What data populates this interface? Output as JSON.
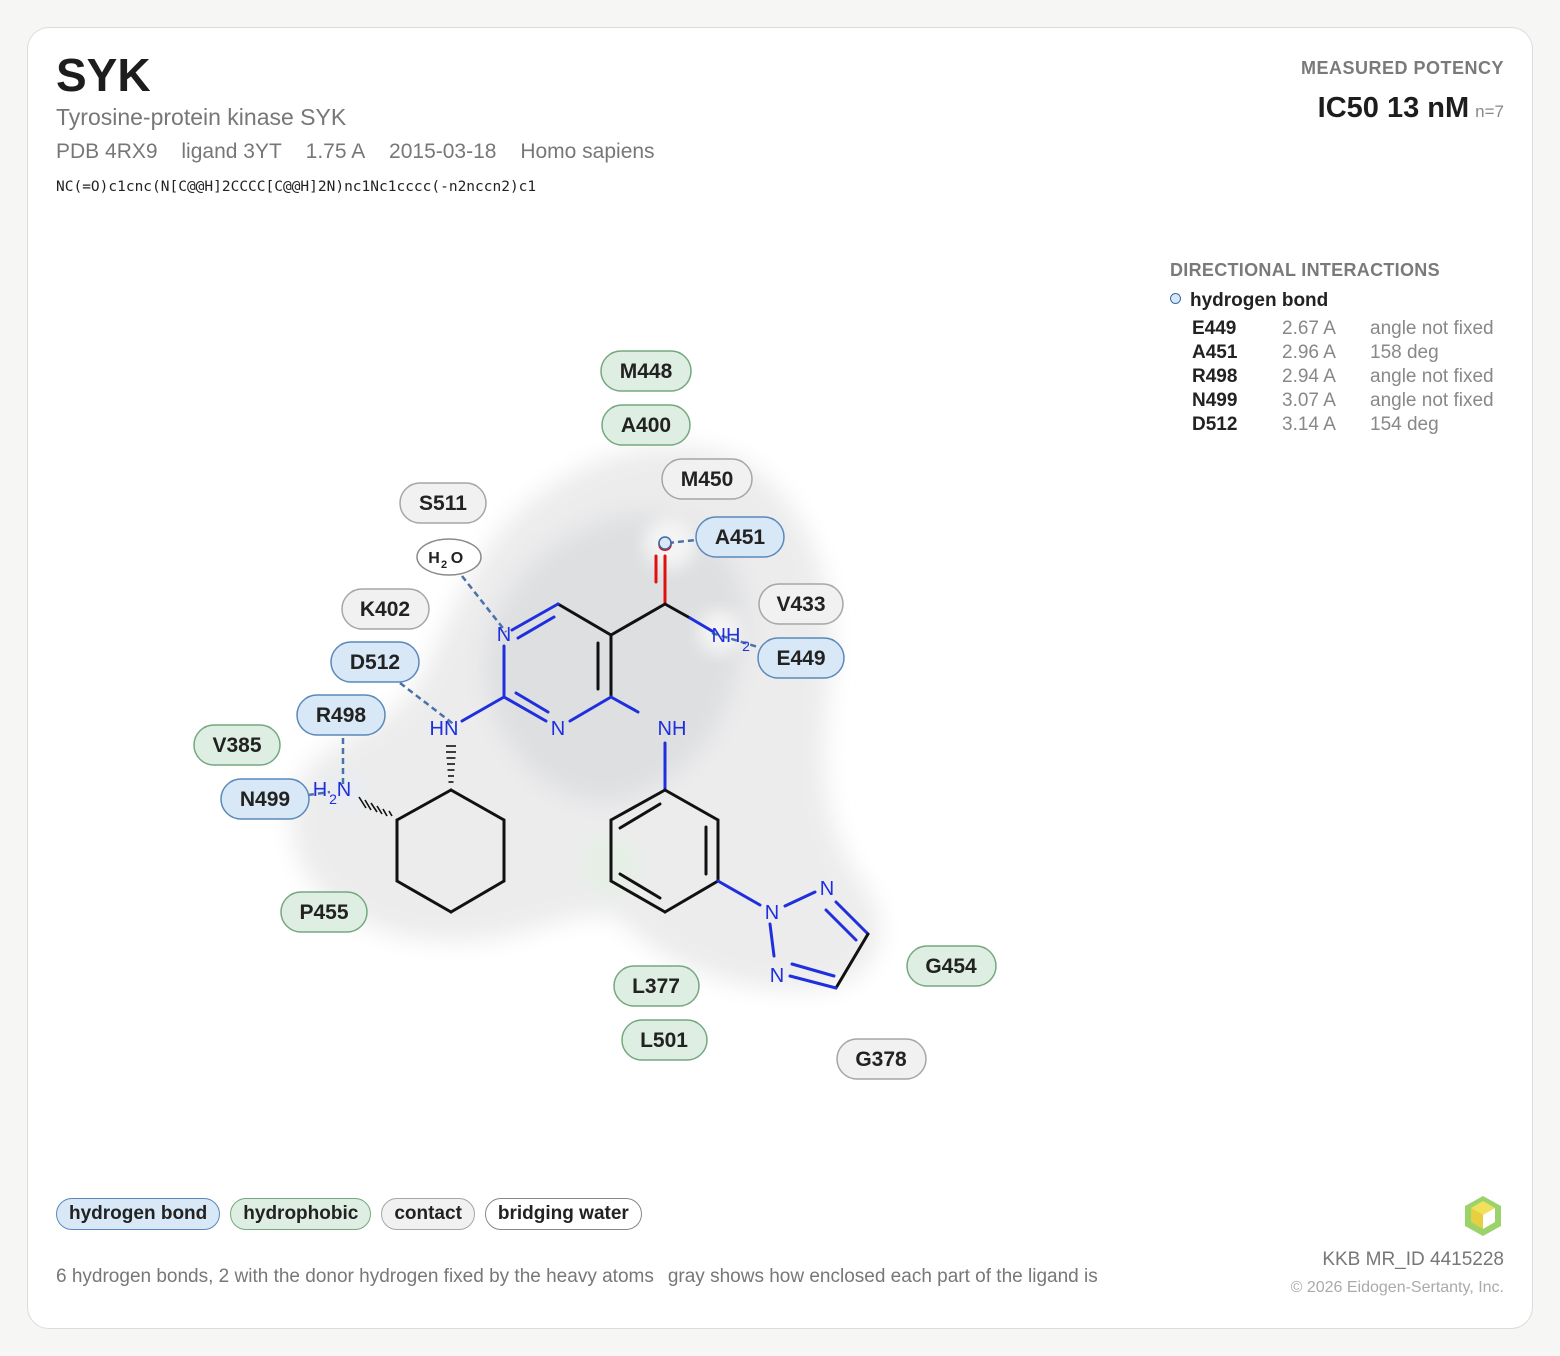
{
  "header": {
    "title": "SYK",
    "subtitle": "Tyrosine-protein kinase SYK",
    "meta": [
      "PDB 4RX9",
      "ligand 3YT",
      "1.75 A",
      "2015-03-18",
      "Homo sapiens"
    ],
    "smiles": "NC(=O)c1cnc(N[C@@H]2CCCC[C@@H]2N)nc1Nc1cccc(-n2nccn2)c1"
  },
  "potency": {
    "label": "MEASURED POTENCY",
    "value": "IC50 13 nM",
    "n": "n=7"
  },
  "interactions": {
    "heading": "DIRECTIONAL INTERACTIONS",
    "type": "hydrogen bond",
    "rows": [
      {
        "residue": "E449",
        "distance": "2.67 A",
        "angle": "angle not fixed"
      },
      {
        "residue": "A451",
        "distance": "2.96 A",
        "angle": "158 deg"
      },
      {
        "residue": "R498",
        "distance": "2.94 A",
        "angle": "angle not fixed"
      },
      {
        "residue": "N499",
        "distance": "3.07 A",
        "angle": "angle not fixed"
      },
      {
        "residue": "D512",
        "distance": "3.14 A",
        "angle": "154 deg"
      }
    ]
  },
  "residues": {
    "M448": {
      "label": "M448",
      "kind": "hydrophobic"
    },
    "A400": {
      "label": "A400",
      "kind": "hydrophobic"
    },
    "M450": {
      "label": "M450",
      "kind": "contact"
    },
    "S511": {
      "label": "S511",
      "kind": "contact"
    },
    "A451": {
      "label": "A451",
      "kind": "hydrogen bond"
    },
    "K402": {
      "label": "K402",
      "kind": "contact"
    },
    "V433": {
      "label": "V433",
      "kind": "contact"
    },
    "D512": {
      "label": "D512",
      "kind": "hydrogen bond"
    },
    "E449": {
      "label": "E449",
      "kind": "hydrogen bond"
    },
    "R498": {
      "label": "R498",
      "kind": "hydrogen bond"
    },
    "V385": {
      "label": "V385",
      "kind": "hydrophobic"
    },
    "N499": {
      "label": "N499",
      "kind": "hydrogen bond"
    },
    "P455": {
      "label": "P455",
      "kind": "hydrophobic"
    },
    "L377": {
      "label": "L377",
      "kind": "hydrophobic"
    },
    "L501": {
      "label": "L501",
      "kind": "hydrophobic"
    },
    "G454": {
      "label": "G454",
      "kind": "hydrophobic"
    },
    "G378": {
      "label": "G378",
      "kind": "contact"
    }
  },
  "atoms": {
    "N_ring1": "N",
    "N_ring2": "N",
    "NH_left": "HN",
    "NH_right": "NH",
    "O_amide": "O",
    "NH2_amide": "NH",
    "NH2_amide_sub": "2",
    "NH2_cyclo": "H",
    "NH2_cyclo_sub": "2",
    "NH2_cyclo_N": "N",
    "N_triazole_1": "N",
    "N_triazole_2": "N",
    "N_triazole_3": "N",
    "water_H": "H",
    "water_sub": "2",
    "water_O": "O"
  },
  "legend": {
    "hbond": "hydrogen bond",
    "hydrophobic": "hydrophobic",
    "contact": "contact",
    "water": "bridging water"
  },
  "colors": {
    "hbond_fill": "#d9e8f6",
    "hbond_stroke": "#5a88bb",
    "hydrophobic_fill": "#dfeee2",
    "hydrophobic_stroke": "#74a87e",
    "contact_fill": "#f1f1f1",
    "contact_stroke": "#a6a6a6",
    "nitrogen": "#1f2fdd",
    "oxygen": "#e01010"
  },
  "footer": {
    "summary": "6 hydrogen bonds, 2 with the donor hydrogen fixed by the heavy atoms",
    "note": "gray shows how enclosed each part of the ligand is",
    "id": "KKB MR_ID 4415228",
    "copyright": "© 2026 Eidogen-Sertanty, Inc.",
    "logo_icon": "hexagon-cube-icon"
  }
}
